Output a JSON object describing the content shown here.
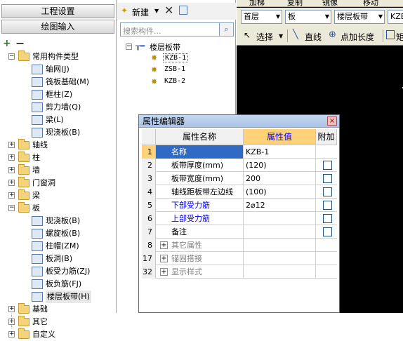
{
  "left_panel": {
    "project_settings": "工程设置",
    "drawing_input": "绘图输入",
    "expand_all": "+",
    "collapse_all": "−",
    "tree": [
      {
        "label": "常用构件类型",
        "level": 0,
        "expand": "−",
        "kind": "folder"
      },
      {
        "label": "轴网(J)",
        "level": 1,
        "kind": "item"
      },
      {
        "label": "筏板基础(M)",
        "level": 1,
        "kind": "item"
      },
      {
        "label": "框柱(Z)",
        "level": 1,
        "kind": "item"
      },
      {
        "label": "剪力墙(Q)",
        "level": 1,
        "kind": "item"
      },
      {
        "label": "梁(L)",
        "level": 1,
        "kind": "item"
      },
      {
        "label": "现浇板(B)",
        "level": 1,
        "kind": "item"
      },
      {
        "label": "轴线",
        "level": 0,
        "expand": "+",
        "kind": "folder"
      },
      {
        "label": "柱",
        "level": 0,
        "expand": "+",
        "kind": "folder"
      },
      {
        "label": "墙",
        "level": 0,
        "expand": "+",
        "kind": "folder"
      },
      {
        "label": "门窗洞",
        "level": 0,
        "expand": "+",
        "kind": "folder"
      },
      {
        "label": "梁",
        "level": 0,
        "expand": "+",
        "kind": "folder"
      },
      {
        "label": "板",
        "level": 0,
        "expand": "−",
        "kind": "folder"
      },
      {
        "label": "现浇板(B)",
        "level": 1,
        "kind": "item"
      },
      {
        "label": "螺旋板(B)",
        "level": 1,
        "kind": "item"
      },
      {
        "label": "柱帽(ZM)",
        "level": 1,
        "kind": "item"
      },
      {
        "label": "板洞(B)",
        "level": 1,
        "kind": "item"
      },
      {
        "label": "板受力筋(ZJ)",
        "level": 1,
        "kind": "item"
      },
      {
        "label": "板负筋(FJ)",
        "level": 1,
        "kind": "item"
      },
      {
        "label": "楼层板带(H)",
        "level": 1,
        "kind": "item",
        "selected": true
      },
      {
        "label": "基础",
        "level": 0,
        "expand": "+",
        "kind": "folder"
      },
      {
        "label": "其它",
        "level": 0,
        "expand": "+",
        "kind": "folder"
      },
      {
        "label": "自定义",
        "level": 0,
        "expand": "+",
        "kind": "folder"
      }
    ]
  },
  "mid_panel": {
    "new_label": "新建",
    "search_placeholder": "搜索构件...",
    "tree_root": "楼层板带",
    "tree_root_expand": "−",
    "items": [
      "KZB-1",
      "ZSB-1",
      "KZB-2"
    ]
  },
  "right_toolbar": {
    "top_items": [
      "加梯",
      "复制",
      "镜像",
      "移动"
    ],
    "floor": "首层",
    "category": "板",
    "type": "楼层板带",
    "member": "KZB-",
    "select": "选择",
    "line": "直线",
    "point_length": "点加长度",
    "rect": "矩"
  },
  "dialog": {
    "title": "属性编辑器",
    "close": "×",
    "headers": {
      "name": "属性名称",
      "value": "属性值",
      "add": "附加"
    },
    "rows": [
      {
        "num": "1",
        "name": "名称",
        "value": "KZB-1",
        "style": "selected",
        "check": false
      },
      {
        "num": "2",
        "name": "板带厚度(mm)",
        "value": "(120)",
        "style": "normal",
        "check": true
      },
      {
        "num": "3",
        "name": "板带宽度(mm)",
        "value": "200",
        "style": "normal",
        "check": true
      },
      {
        "num": "4",
        "name": "轴线距板带左边线",
        "value": "(100)",
        "style": "normal",
        "check": true
      },
      {
        "num": "5",
        "name": "下部受力筋",
        "value": "2⌀12",
        "style": "blue",
        "check": true
      },
      {
        "num": "6",
        "name": "上部受力筋",
        "value": "",
        "style": "blue",
        "check": true
      },
      {
        "num": "7",
        "name": "备注",
        "value": "",
        "style": "normal",
        "check": true
      },
      {
        "num": "8",
        "name": "其它属性",
        "value": "",
        "style": "group",
        "check": false
      },
      {
        "num": "17",
        "name": "锚固搭接",
        "value": "",
        "style": "group",
        "check": false
      },
      {
        "num": "32",
        "name": "显示样式",
        "value": "",
        "style": "group",
        "check": false
      }
    ]
  },
  "colors": {
    "selected_row": "#316ac5",
    "value_header": "#ffd27a",
    "canvas": "#000000"
  }
}
